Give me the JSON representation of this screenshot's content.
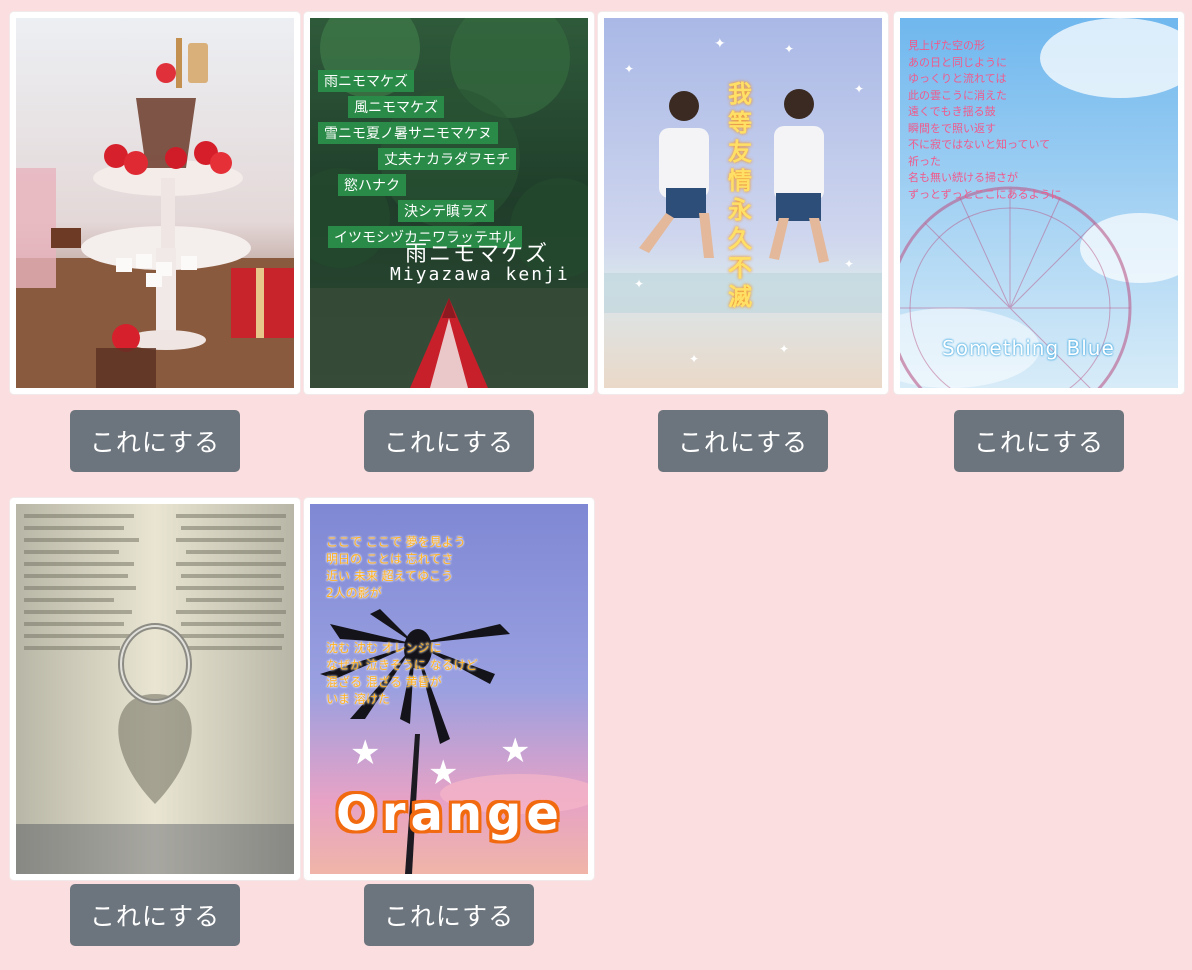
{
  "cards": [
    {
      "id": "dessert",
      "alt": "",
      "button_label": "これにする"
    },
    {
      "id": "ame-ni-mo-makezu",
      "title": "雨ニモマケズ",
      "subtitle": "Miyazawa kenji",
      "lines": [
        "雨ニモマケズ",
        "風ニモマケズ",
        "雪ニモ夏ノ暑サニモマケヌ",
        "丈夫ナカラダヲモチ",
        "慾ハナク",
        "決シテ瞋ラズ",
        "イツモシヅカニワラッテヰル"
      ],
      "button_label": "これにする"
    },
    {
      "id": "friendship",
      "title": "我等友情永久不滅",
      "button_label": "これにする"
    },
    {
      "id": "something-blue",
      "title": "Something Blue",
      "lines": [
        "見上げた空の形",
        "あの日と同じように",
        "ゆっくりと流れては",
        "此の雲こうに消えた",
        "遠くでもき揺る鼓",
        "瞬間をで照い返す",
        "不に寂ではないと知っていて",
        "祈った",
        "名も無い続ける掃さが",
        "ずっとずっとここにあるように"
      ],
      "button_label": "これにする"
    },
    {
      "id": "book-ring",
      "button_label": "これにする"
    },
    {
      "id": "orange",
      "title": "Orange",
      "lines": [
        "ここで ここで 夢を見よう",
        "明日の ことは 忘れてさ",
        "近い 未来 超えてゆこう",
        "2人の影が",
        "沈む 沈む オレンジに",
        "なぜか 泣きそうに なるけど",
        "混ざる 混ざる 黄昏が",
        "いま 溶けた"
      ],
      "button_label": "これにする"
    }
  ],
  "colors": {
    "page_bg": "#fbdfe0",
    "button_bg": "#6c757d",
    "button_text": "#ffffff"
  }
}
